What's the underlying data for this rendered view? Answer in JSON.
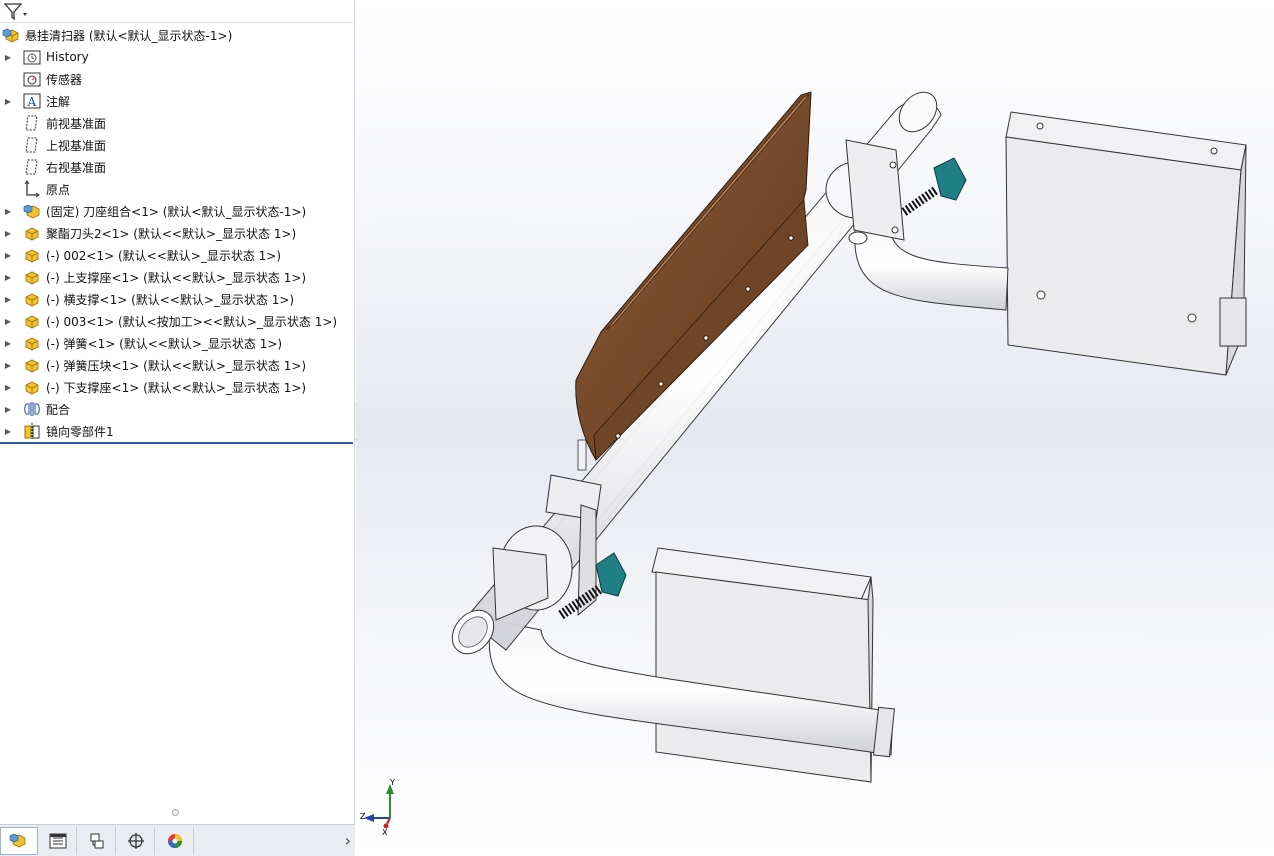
{
  "tree": {
    "root": {
      "label": "悬挂清扫器  (默认<默认_显示状态-1>)"
    },
    "items": [
      {
        "label": "History",
        "icon": "history-folder-icon",
        "expandable": true
      },
      {
        "label": "传感器",
        "icon": "sensor-icon",
        "expandable": false
      },
      {
        "label": "注解",
        "icon": "annotation-icon",
        "expandable": true
      },
      {
        "label": "前视基准面",
        "icon": "plane-icon",
        "expandable": false
      },
      {
        "label": "上视基准面",
        "icon": "plane-icon",
        "expandable": false
      },
      {
        "label": "右视基准面",
        "icon": "plane-icon",
        "expandable": false
      },
      {
        "label": "原点",
        "icon": "origin-icon",
        "expandable": false
      },
      {
        "label": "(固定) 刀座组合<1> (默认<默认_显示状态-1>)",
        "icon": "subassembly-icon",
        "expandable": true
      },
      {
        "label": "聚酯刀头2<1> (默认<<默认>_显示状态 1>)",
        "icon": "part-icon",
        "expandable": true
      },
      {
        "label": "(-) 002<1> (默认<<默认>_显示状态 1>)",
        "icon": "part-icon",
        "expandable": true
      },
      {
        "label": "(-) 上支撑座<1> (默认<<默认>_显示状态 1>)",
        "icon": "part-icon",
        "expandable": true
      },
      {
        "label": "(-) 横支撑<1> (默认<<默认>_显示状态 1>)",
        "icon": "part-icon",
        "expandable": true
      },
      {
        "label": "(-) 003<1> (默认<按加工><<默认>_显示状态 1>)",
        "icon": "part-icon",
        "expandable": true
      },
      {
        "label": "(-) 弹簧<1> (默认<<默认>_显示状态 1>)",
        "icon": "part-icon",
        "expandable": true
      },
      {
        "label": "(-) 弹簧压块<1> (默认<<默认>_显示状态 1>)",
        "icon": "part-icon",
        "expandable": true
      },
      {
        "label": "(-) 下支撑座<1> (默认<<默认>_显示状态 1>)",
        "icon": "part-icon",
        "expandable": true
      },
      {
        "label": "配合",
        "icon": "mates-icon",
        "expandable": true
      },
      {
        "label": "镜向零部件1",
        "icon": "mirror-component-icon",
        "expandable": true
      }
    ]
  },
  "bottom_tabs": [
    {
      "name": "featuremanager-tab-icon",
      "active": true
    },
    {
      "name": "propertymanager-tab-icon",
      "active": false
    },
    {
      "name": "configurationmanager-tab-icon",
      "active": false
    },
    {
      "name": "dimxpert-tab-icon",
      "active": false
    },
    {
      "name": "display-manager-tab-icon",
      "active": false
    }
  ],
  "triad": {
    "x": "X",
    "y": "Y",
    "z": "Z"
  },
  "colors": {
    "part_yellow": "#f2c12e",
    "blade_brown": "#7a4e2c",
    "knob_teal": "#1f7f84",
    "tree_end_line": "#2a5ea8"
  }
}
